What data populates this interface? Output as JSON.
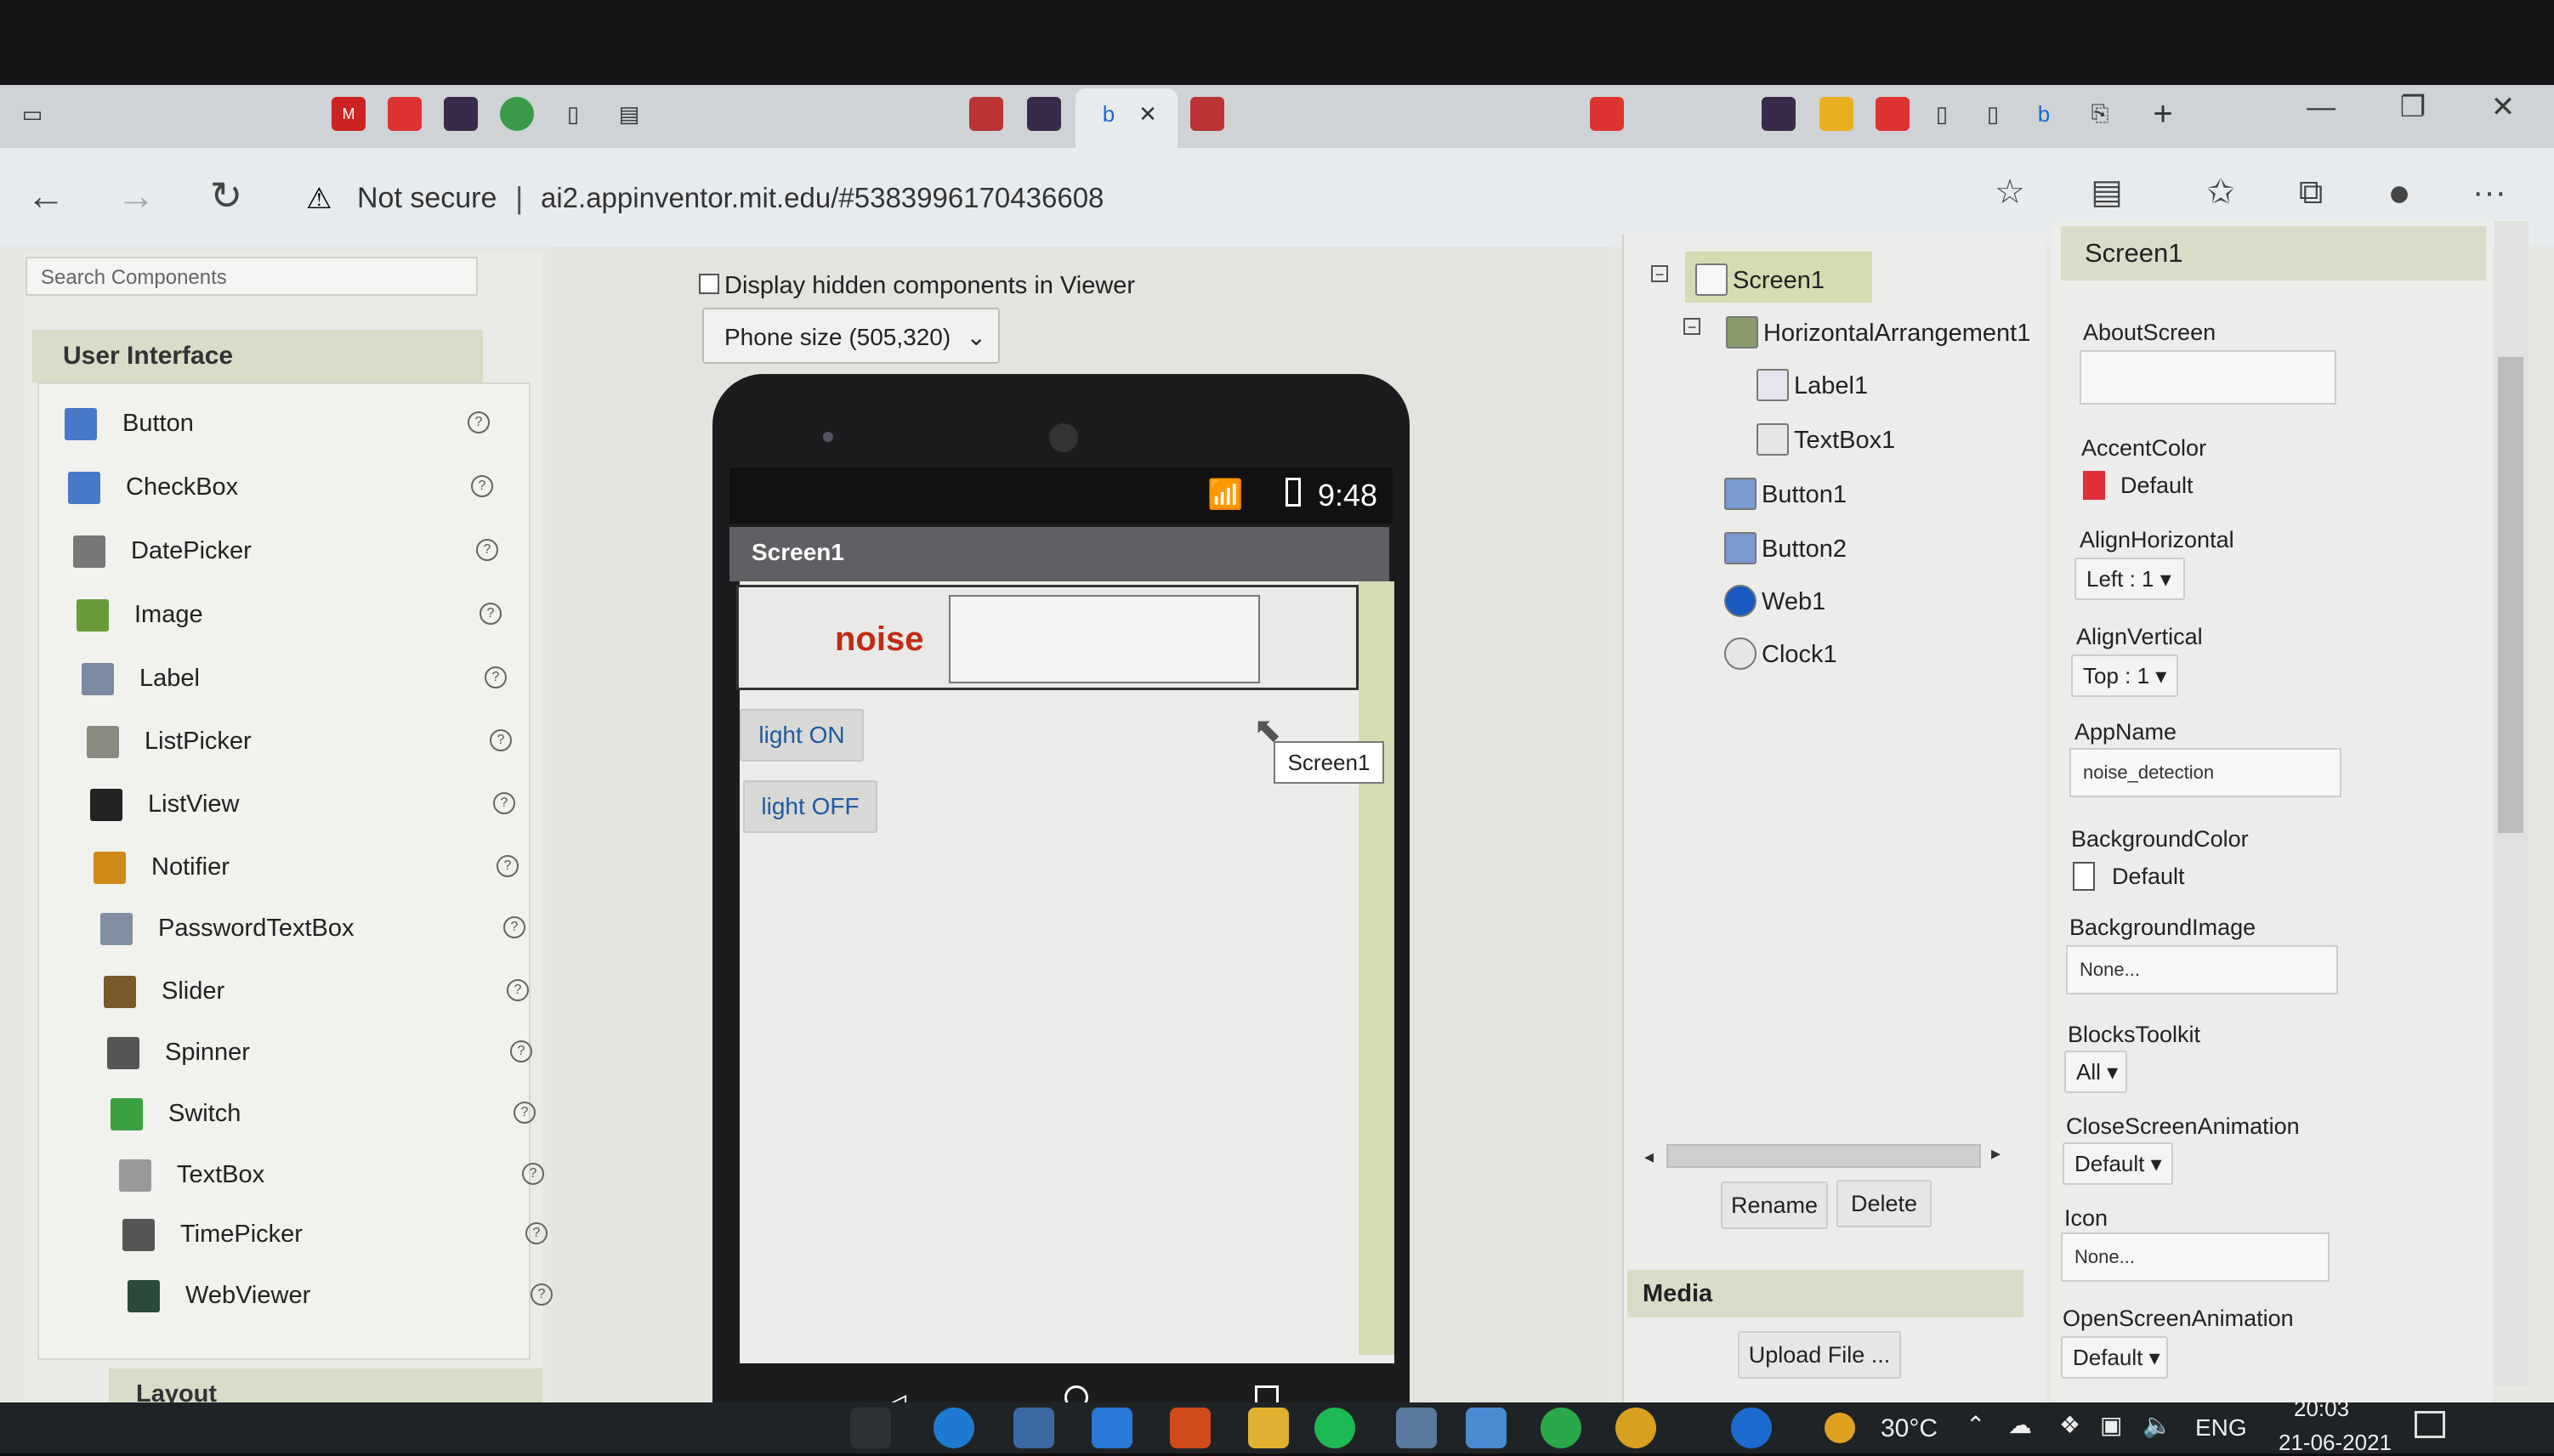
{
  "browser": {
    "security_label": "Not secure",
    "url": "ai2.appinventor.mit.edu/#5383996170436608",
    "close_tab_glyph": "✕",
    "new_tab_glyph": "+",
    "win_min": "—",
    "win_restore": "❐",
    "win_close": "✕",
    "back_glyph": "←",
    "forward_glyph": "→",
    "reload_glyph": "↻",
    "more_glyph": "···"
  },
  "palette": {
    "search_placeholder": "Search Components",
    "section_title": "User Interface",
    "items": [
      {
        "label": "Button",
        "icon": "button-icon",
        "color": "#4a78c8"
      },
      {
        "label": "CheckBox",
        "icon": "checkbox-icon",
        "color": "#4a78c8"
      },
      {
        "label": "DatePicker",
        "icon": "datepicker-icon",
        "color": "#777777"
      },
      {
        "label": "Image",
        "icon": "image-icon",
        "color": "#6a9a3a"
      },
      {
        "label": "Label",
        "icon": "label-icon",
        "color": "#7a8aa0"
      },
      {
        "label": "ListPicker",
        "icon": "listpicker-icon",
        "color": "#8a8a80"
      },
      {
        "label": "ListView",
        "icon": "listview-icon",
        "color": "#222222"
      },
      {
        "label": "Notifier",
        "icon": "notifier-icon",
        "color": "#d08a1a"
      },
      {
        "label": "PasswordTextBox",
        "icon": "password-icon",
        "color": "#8090a0"
      },
      {
        "label": "Slider",
        "icon": "slider-icon",
        "color": "#7a5a2a"
      },
      {
        "label": "Spinner",
        "icon": "spinner-icon",
        "color": "#555555"
      },
      {
        "label": "Switch",
        "icon": "switch-icon",
        "color": "#3aa040"
      },
      {
        "label": "TextBox",
        "icon": "textbox-icon",
        "color": "#999999"
      },
      {
        "label": "TimePicker",
        "icon": "timepicker-icon",
        "color": "#555555"
      },
      {
        "label": "WebViewer",
        "icon": "webviewer-icon",
        "color": "#2a4a3a"
      }
    ],
    "help_glyph": "?",
    "layout_title": "Layout"
  },
  "viewer": {
    "hidden_label": "Display hidden components in Viewer",
    "phone_size": "Phone size (505,320)",
    "status_time": "9:48",
    "screen_title": "Screen1",
    "label_text": "noise",
    "button1": "light ON",
    "button2": "light OFF",
    "tooltip": "Screen1"
  },
  "tree": {
    "nodes": [
      {
        "label": "Screen1",
        "icon": "screen-icon"
      },
      {
        "label": "HorizontalArrangement1",
        "icon": "horizontal-arrangement-icon"
      },
      {
        "label": "Label1",
        "icon": "label-icon"
      },
      {
        "label": "TextBox1",
        "icon": "textbox-icon"
      },
      {
        "label": "Button1",
        "icon": "button-icon"
      },
      {
        "label": "Button2",
        "icon": "button-icon"
      },
      {
        "label": "Web1",
        "icon": "web-icon"
      },
      {
        "label": "Clock1",
        "icon": "clock-icon"
      }
    ],
    "rename": "Rename",
    "delete": "Delete",
    "media_title": "Media",
    "upload": "Upload File ..."
  },
  "properties": {
    "title": "Screen1",
    "about_label": "AboutScreen",
    "about_value": "",
    "accent_label": "AccentColor",
    "accent_value": "Default",
    "accent_color": "#e0303a",
    "alignh_label": "AlignHorizontal",
    "alignh_value": "Left : 1 ▾",
    "alignv_label": "AlignVertical",
    "alignv_value": "Top : 1 ▾",
    "appname_label": "AppName",
    "appname_value": "noise_detection",
    "bgcolor_label": "BackgroundColor",
    "bgcolor_value": "Default",
    "bgimage_label": "BackgroundImage",
    "bgimage_value": "None...",
    "blocks_label": "BlocksToolkit",
    "blocks_value": "All ▾",
    "close_anim_label": "CloseScreenAnimation",
    "close_anim_value": "Default ▾",
    "icon_label": "Icon",
    "icon_value": "None...",
    "open_anim_label": "OpenScreenAnimation",
    "open_anim_value": "Default ▾"
  },
  "taskbar": {
    "temperature": "30°C",
    "language": "ENG",
    "time": "20:03",
    "date": "21-06-2021"
  }
}
